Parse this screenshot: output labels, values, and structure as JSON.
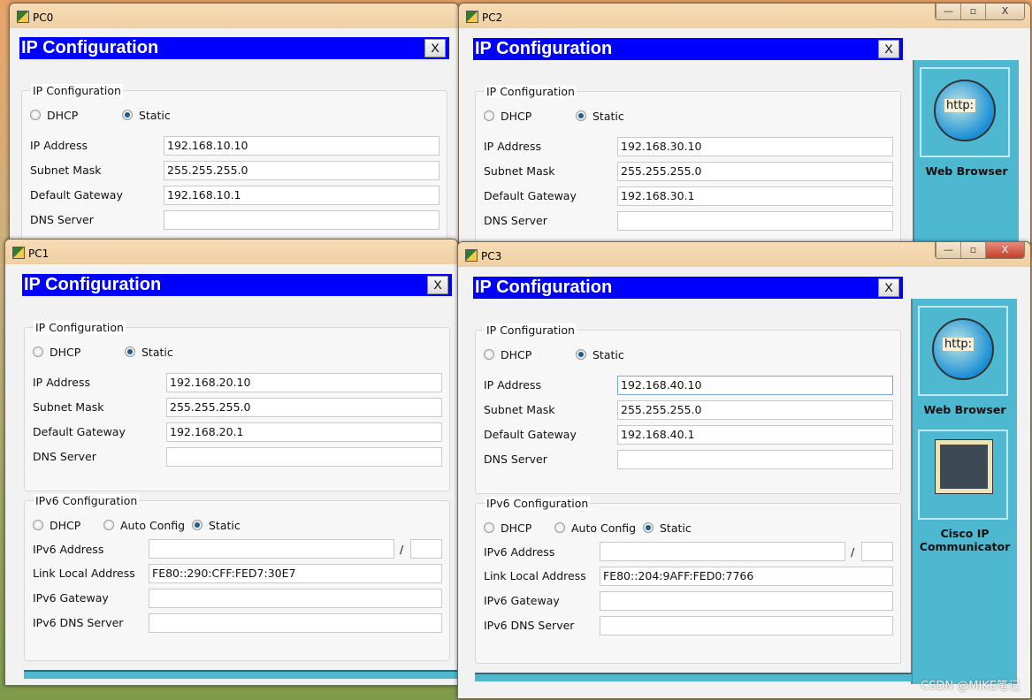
{
  "windows": [
    {
      "id": "pc0",
      "title": "PC0",
      "dialog_title": "IP Configuration",
      "close_label": "X",
      "ipv4": {
        "group_label": "IP Configuration",
        "dhcp_label": "DHCP",
        "static_label": "Static",
        "mode": "Static",
        "fields": [
          {
            "label": "IP Address",
            "value": "192.168.10.10"
          },
          {
            "label": "Subnet Mask",
            "value": "255.255.255.0"
          },
          {
            "label": "Default Gateway",
            "value": "192.168.10.1"
          },
          {
            "label": "DNS Server",
            "value": ""
          }
        ]
      }
    },
    {
      "id": "pc2",
      "title": "PC2",
      "dialog_title": "IP Configuration",
      "close_label": "X",
      "window_buttons": {
        "minimize": "—",
        "maximize": "▫",
        "close": "X"
      },
      "side_panel": [
        {
          "label": "Web Browser",
          "icon": "web-browser-icon"
        }
      ],
      "ipv4": {
        "group_label": "IP Configuration",
        "dhcp_label": "DHCP",
        "static_label": "Static",
        "mode": "Static",
        "fields": [
          {
            "label": "IP Address",
            "value": "192.168.30.10"
          },
          {
            "label": "Subnet Mask",
            "value": "255.255.255.0"
          },
          {
            "label": "Default Gateway",
            "value": "192.168.30.1"
          },
          {
            "label": "DNS Server",
            "value": ""
          }
        ]
      }
    },
    {
      "id": "pc1",
      "title": "PC1",
      "dialog_title": "IP Configuration",
      "close_label": "X",
      "ipv4": {
        "group_label": "IP Configuration",
        "dhcp_label": "DHCP",
        "static_label": "Static",
        "mode": "Static",
        "fields": [
          {
            "label": "IP Address",
            "value": "192.168.20.10"
          },
          {
            "label": "Subnet Mask",
            "value": "255.255.255.0"
          },
          {
            "label": "Default Gateway",
            "value": "192.168.20.1"
          },
          {
            "label": "DNS Server",
            "value": ""
          }
        ]
      },
      "ipv6": {
        "group_label": "IPv6 Configuration",
        "dhcp_label": "DHCP",
        "auto_label": "Auto Config",
        "static_label": "Static",
        "mode": "Static",
        "slash": "/",
        "address_label": "IPv6 Address",
        "address": "",
        "prefix": "",
        "fields": [
          {
            "label": "Link Local Address",
            "value": "FE80::290:CFF:FED7:30E7"
          },
          {
            "label": "IPv6 Gateway",
            "value": ""
          },
          {
            "label": "IPv6 DNS Server",
            "value": ""
          }
        ]
      }
    },
    {
      "id": "pc3",
      "title": "PC3",
      "dialog_title": "IP Configuration",
      "close_label": "X",
      "window_buttons": {
        "minimize": "—",
        "maximize": "▫",
        "close": "X"
      },
      "side_panel": [
        {
          "label": "Web Browser",
          "icon": "web-browser-icon"
        },
        {
          "label": "Cisco IP Communicator",
          "icon": "ip-communicator-icon"
        }
      ],
      "ipv4": {
        "group_label": "IP Configuration",
        "dhcp_label": "DHCP",
        "static_label": "Static",
        "mode": "Static",
        "fields": [
          {
            "label": "IP Address",
            "value": "192.168.40.10"
          },
          {
            "label": "Subnet Mask",
            "value": "255.255.255.0"
          },
          {
            "label": "Default Gateway",
            "value": "192.168.40.1"
          },
          {
            "label": "DNS Server",
            "value": ""
          }
        ]
      },
      "ipv6": {
        "group_label": "IPv6 Configuration",
        "dhcp_label": "DHCP",
        "auto_label": "Auto Config",
        "static_label": "Static",
        "mode": "Static",
        "slash": "/",
        "address_label": "IPv6 Address",
        "address": "",
        "prefix": "",
        "fields": [
          {
            "label": "Link Local Address",
            "value": "FE80::204:9AFF:FED0:7766"
          },
          {
            "label": "IPv6 Gateway",
            "value": ""
          },
          {
            "label": "IPv6 DNS Server",
            "value": ""
          }
        ]
      }
    }
  ],
  "watermark": "CSDN @MIKE笔记",
  "colors": {
    "dialog_header": "#0000ff",
    "side_panel": "#4db8cf"
  }
}
